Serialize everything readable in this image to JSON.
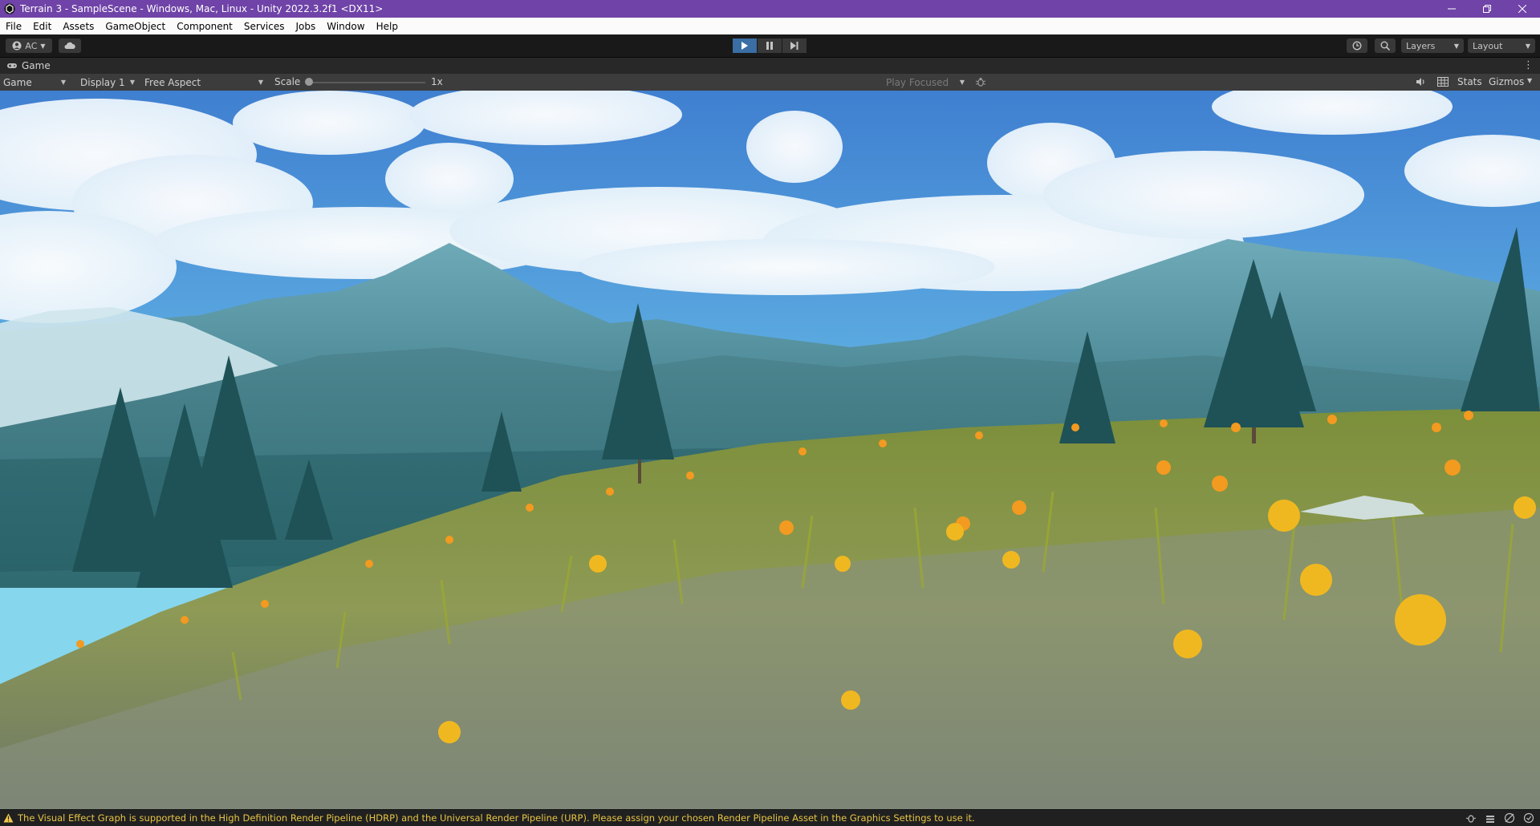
{
  "window": {
    "title": "Terrain 3 - SampleScene - Windows, Mac, Linux - Unity 2022.3.2f1 <DX11>",
    "buttons": [
      "minimize-icon",
      "restore-icon",
      "close-icon"
    ],
    "accent": "#6f43a7"
  },
  "menu": {
    "items": [
      "File",
      "Edit",
      "Assets",
      "GameObject",
      "Component",
      "Services",
      "Jobs",
      "Window",
      "Help"
    ]
  },
  "toolbar": {
    "account_label": "AC",
    "cloud_icon": "cloud-icon",
    "play_icon": "play-icon",
    "pause_icon": "pause-icon",
    "step_icon": "step-icon",
    "history_icon": "history-icon",
    "search_icon": "search-icon",
    "layers_label": "Layers",
    "layout_label": "Layout",
    "play_color": "#3a6ea5"
  },
  "tab": {
    "label": "Game",
    "icon": "gamepad-icon"
  },
  "gamebar": {
    "view_label": "Game",
    "display_label": "Display 1",
    "aspect_label": "Free Aspect",
    "scale_label": "Scale",
    "scale_value": "1x",
    "scale_fraction": 0.0,
    "play_focused_label": "Play Focused",
    "bug_icon": "bug-icon",
    "audio_icon": "speaker-icon",
    "stats_icon": "grid-icon",
    "stats_label": "Stats",
    "gizmos_label": "Gizmos"
  },
  "status": {
    "icon": "warning-icon",
    "message": "The Visual Effect Graph is supported in the High Definition Render Pipeline (HDRP) and the Universal Render Pipeline (URP). Please assign your chosen Render Pipeline Asset in the Graphics Settings to use it.",
    "message_color": "#e6c545",
    "right_icons": [
      "debug-icon",
      "layers-stack-icon",
      "no-network-icon",
      "check-circle-icon"
    ]
  }
}
